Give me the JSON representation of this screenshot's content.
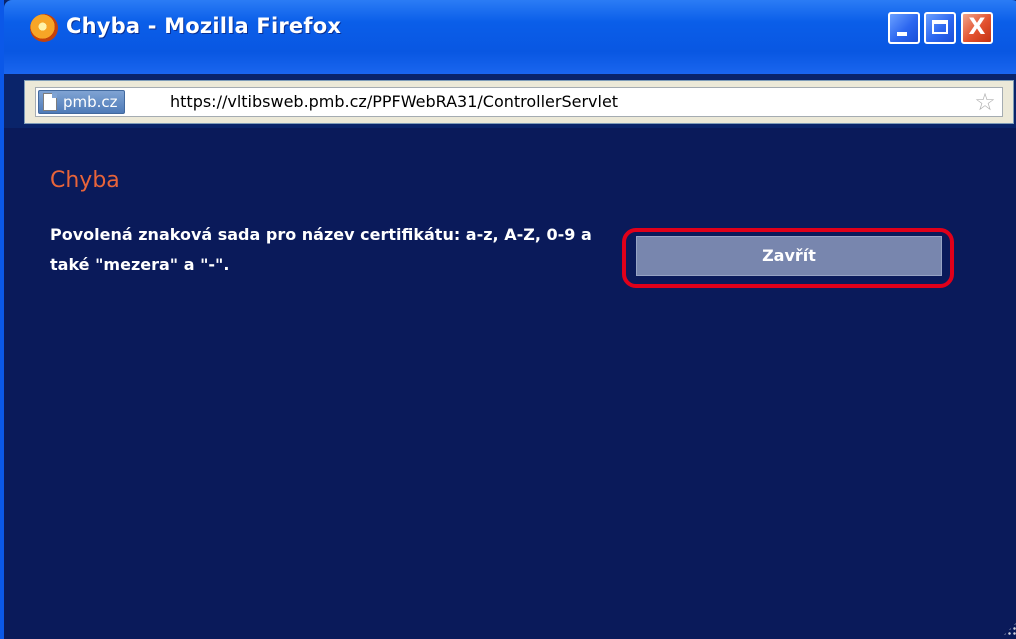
{
  "window": {
    "title": "Chyba - Mozilla Firefox",
    "icon": "firefox-icon",
    "buttons": {
      "minimize": "minimize-icon",
      "maximize": "maximize-icon",
      "close": "close-icon",
      "close_glyph": "X"
    }
  },
  "address_bar": {
    "site_label": "pmb.cz",
    "url": "https://vltibsweb.pmb.cz/PPFWebRA31/ControllerServlet",
    "bookmark_icon": "star-icon"
  },
  "content": {
    "heading": "Chyba",
    "message": "Povolená znaková sada pro název certifikátu: a-z, A-Z, 0-9 a také \"mezera\" a \"-\".",
    "close_button_label": "Zavřít"
  },
  "colors": {
    "title_bar": "#0a5ee9",
    "content_background": "#0a1a5a",
    "heading": "#e8643a",
    "button": "#7886ae",
    "highlight": "#e0001a"
  }
}
